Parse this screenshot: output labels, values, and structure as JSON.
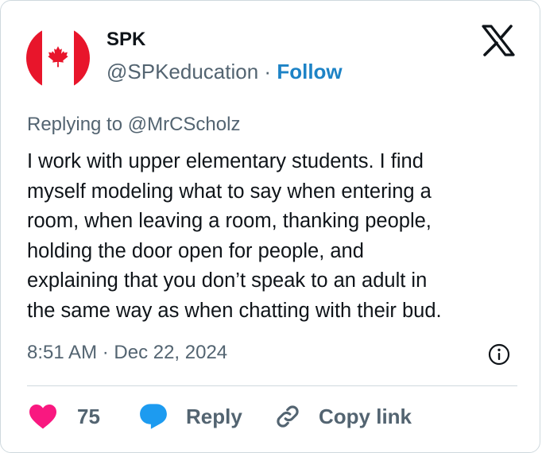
{
  "author": {
    "name": "SPK",
    "handle": "@SPKeducation",
    "separator": "·",
    "follow_label": "Follow",
    "avatar_icon": "canadian-flag-icon"
  },
  "replying_to": "Replying to @MrCScholz",
  "tweet_lines": [
    "I work with upper elementary students. I find",
    "myself modeling what to say when entering a",
    "room, when leaving a room, thanking people,",
    "holding the door open for people, and",
    "explaining that you don’t speak to an adult in",
    "the same way as when chatting with their bud."
  ],
  "timestamp": "8:51 AM · Dec 22, 2024",
  "actions": {
    "like_count": "75",
    "reply_label": "Reply",
    "copy_link_label": "Copy link"
  },
  "colors": {
    "accent": "#1d83c6",
    "like": "#f91880",
    "reply_icon": "#1d9bf0",
    "secondary_text": "#536471",
    "flag_red": "#e8152b",
    "border": "#cfd9de"
  },
  "icons": [
    "x-logo-icon",
    "info-icon",
    "heart-icon",
    "reply-bubble-icon",
    "link-icon"
  ]
}
